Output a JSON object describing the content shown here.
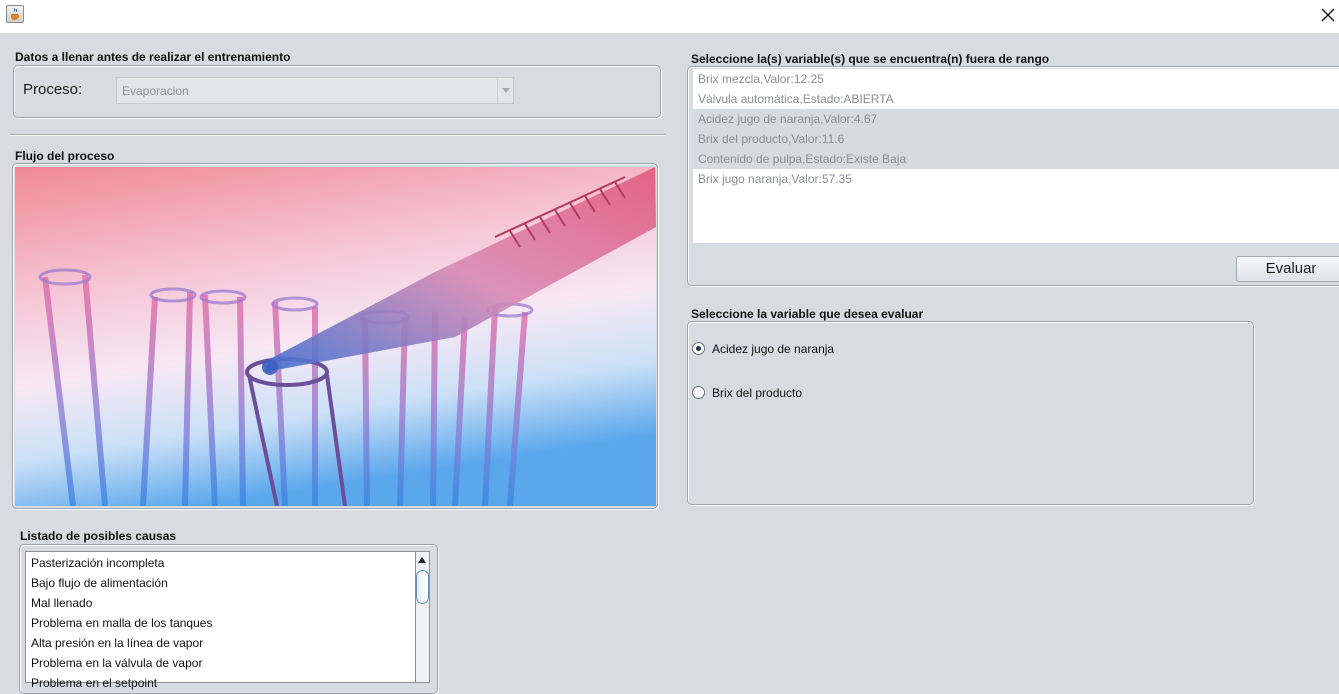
{
  "window": {
    "app_icon": "java-cup-icon",
    "close_icon": "close-icon"
  },
  "datos": {
    "title": "Datos a llenar antes de realizar el entrenamiento",
    "proceso_label": "Proceso:",
    "proceso_value": "Evaporacion"
  },
  "flujo": {
    "title": "Flujo del proceso",
    "image": "test-tubes-and-pipette-photo"
  },
  "variables_fuera": {
    "title": "Seleccione la(s) variable(s) que se encuentra(n) fuera de rango",
    "items": [
      {
        "label": "Brix mezcla,Valor:12.25",
        "selected": false
      },
      {
        "label": "Válvula automática,Estado:ABIERTA",
        "selected": false
      },
      {
        "label": "Acidez jugo de naranja,Valor:4.67",
        "selected": true
      },
      {
        "label": "Brix del producto,Valor:11.6",
        "selected": true
      },
      {
        "label": "Contenido de pulpa,Estado:Existe Baja",
        "selected": true
      },
      {
        "label": "Brix jugo naranja,Valor:57.35",
        "selected": false
      }
    ],
    "evaluar_label": "Evaluar"
  },
  "variable_evaluar": {
    "title": "Seleccione la variable que desea evaluar",
    "options": [
      {
        "label": "Acidez jugo de naranja",
        "checked": true
      },
      {
        "label": "Brix del producto",
        "checked": false
      }
    ]
  },
  "causas": {
    "title": "Listado de posibles causas",
    "items": [
      "Pasterización incompleta",
      "Bajo flujo de alimentación",
      "Mal llenado",
      "Problema en malla de los tanques",
      "Alta presión en la línea de vapor",
      "Problema en la válvula de vapor",
      "Problema en el setpoint"
    ]
  },
  "colors": {
    "background": "#d8dbe2",
    "radio_dot": "#24324f",
    "disabled_text": "#8b8d92"
  }
}
